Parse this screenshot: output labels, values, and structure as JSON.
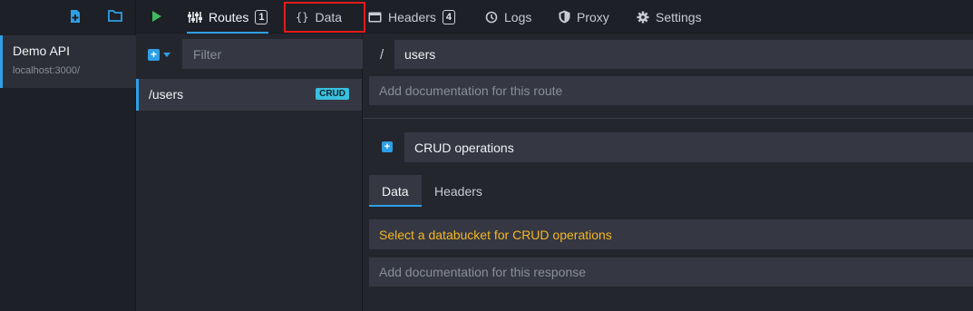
{
  "environment": {
    "toolbar_icons": [
      "new-file-icon",
      "folder-icon"
    ],
    "name": "Demo API",
    "host": "localhost:3000/"
  },
  "topbar": {
    "tabs": [
      {
        "label": "Routes",
        "badge": "1",
        "icon": "routes-icon",
        "active": true
      },
      {
        "label": "Data",
        "icon": "braces-icon",
        "active": false
      },
      {
        "label": "Headers",
        "badge": "4",
        "icon": "headers-icon",
        "active": false
      },
      {
        "label": "Logs",
        "icon": "history-icon",
        "active": false
      },
      {
        "label": "Proxy",
        "icon": "shield-icon",
        "active": false
      },
      {
        "label": "Settings",
        "icon": "gear-icon",
        "active": false
      }
    ]
  },
  "routes": {
    "filter_placeholder": "Filter",
    "items": [
      {
        "path": "/users",
        "tag": "CRUD"
      }
    ]
  },
  "route_detail": {
    "prefix": "/",
    "path": "users",
    "doc_placeholder": "Add documentation for this route",
    "response_label": "CRUD operations",
    "subtabs": [
      "Data",
      "Headers"
    ],
    "bucket_prompt": "Select a databucket for CRUD operations",
    "response_doc_placeholder": "Add documentation for this response"
  },
  "colors": {
    "accent": "#2e9fe6",
    "play": "#3dbb5d",
    "warning": "#f5b623",
    "tag": "#39c0de",
    "highlight": "#e31b1b"
  }
}
